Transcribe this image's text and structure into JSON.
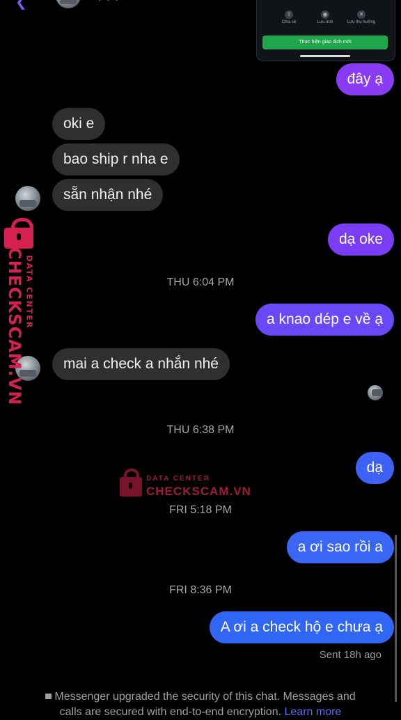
{
  "header": {
    "partial_title": "· · ·"
  },
  "shared_card": {
    "actions": [
      "Chia sẻ",
      "Lưu ảnh",
      "Lưu thụ hưởng"
    ],
    "cta_label": "Thực hiện giao dịch mới"
  },
  "messages": [
    {
      "from": "me",
      "text": "đây ạ",
      "color": "#8a3cf5"
    },
    {
      "from": "them",
      "text": "oki e"
    },
    {
      "from": "them",
      "text": "bao ship r nha e"
    },
    {
      "from": "them",
      "text": "sẵn nhận nhé"
    },
    {
      "from": "me",
      "text": "dạ oke",
      "color": "#7a3cf5"
    },
    {
      "from": "me",
      "text": "a knao dép e về ạ",
      "color": "#6a48f6"
    },
    {
      "from": "them",
      "text": "mai a check a nhắn nhé"
    },
    {
      "from": "me",
      "text": "dạ",
      "color": "#3f62f6"
    },
    {
      "from": "me",
      "text": "a ơi sao rồi a",
      "color": "#3a66f6"
    },
    {
      "from": "me",
      "text": "A ơi a check hộ e chưa ạ",
      "color": "#3166f5"
    }
  ],
  "timestamps": [
    "THU 6:04 PM",
    "THU 6:38 PM",
    "FRI 5:18 PM",
    "FRI 8:36 PM"
  ],
  "status": "Sent 18h ago",
  "footer": {
    "lock_icon": "lock-icon",
    "line1": "Messenger upgraded the security of this chat. Messages and",
    "line2": "calls are secured with end-to-end encryption.",
    "learn_more": "Learn more"
  },
  "watermark": {
    "data_center": "DATA CENTER",
    "brand": "CHECKSCAM.VN"
  },
  "colors": {
    "background": "#000000",
    "incoming_bubble": "#2f2f2f",
    "watermark": "#d6204f",
    "link": "#5b6cf6"
  }
}
